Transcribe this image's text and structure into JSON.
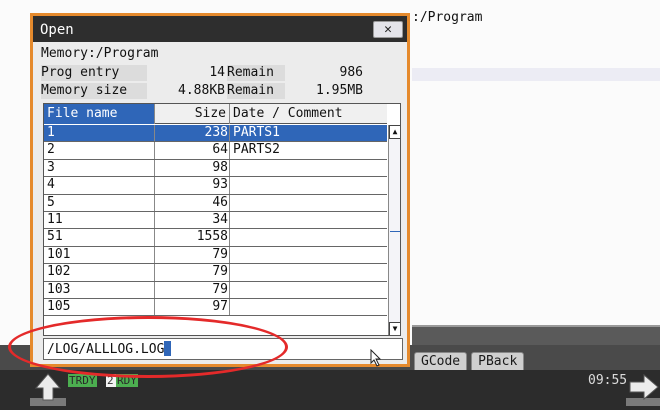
{
  "background": {
    "path_fragment": ":/Program"
  },
  "dialog": {
    "title": "Open",
    "close_label": "✕",
    "memory_path": "Memory:/Program",
    "info": {
      "prog_entry_label": "Prog entry",
      "prog_entry_value": "14",
      "remain_label_1": "Remain",
      "remain_value_1": "986",
      "memory_size_label": "Memory size",
      "memory_size_value": "4.88KB",
      "remain_label_2": "Remain",
      "remain_value_2": "1.95MB"
    },
    "table": {
      "columns": [
        "File name",
        "Size",
        "Date / Comment"
      ],
      "rows": [
        {
          "name": "1",
          "size": "238",
          "comment": "PARTS1",
          "selected": true
        },
        {
          "name": "2",
          "size": "64",
          "comment": "PARTS2"
        },
        {
          "name": "3",
          "size": "98",
          "comment": ""
        },
        {
          "name": "4",
          "size": "93",
          "comment": ""
        },
        {
          "name": "5",
          "size": "46",
          "comment": ""
        },
        {
          "name": "11",
          "size": "34",
          "comment": ""
        },
        {
          "name": "51",
          "size": "1558",
          "comment": ""
        },
        {
          "name": "101",
          "size": "79",
          "comment": ""
        },
        {
          "name": "102",
          "size": "79",
          "comment": ""
        },
        {
          "name": "103",
          "size": "79",
          "comment": ""
        },
        {
          "name": "105",
          "size": "97",
          "comment": ""
        }
      ]
    },
    "filename_value": "/LOG/ALLLOG.LOG"
  },
  "bottom": {
    "tabs": [
      "GCode",
      "PBack"
    ],
    "clock": "09:55",
    "status_1": "TRDY",
    "status_num": "2",
    "status_2": "RDY"
  },
  "colors": {
    "selection": "#2f66b8",
    "dialog_border": "#e58a2d",
    "annotation": "#e42a2a",
    "ready_green": "#4caf50"
  }
}
